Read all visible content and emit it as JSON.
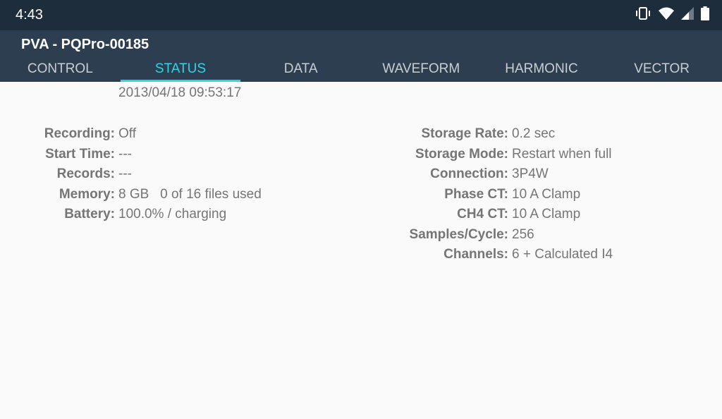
{
  "status_bar": {
    "time": "4:43",
    "icons": [
      "vibrate-icon",
      "wifi-icon",
      "signal-icon",
      "battery-icon"
    ]
  },
  "app_bar": {
    "title": "PVA - PQPro-00185",
    "tabs": [
      {
        "label": "CONTROL",
        "active": false
      },
      {
        "label": "STATUS",
        "active": true
      },
      {
        "label": "DATA",
        "active": false
      },
      {
        "label": "WAVEFORM",
        "active": false
      },
      {
        "label": "HARMONIC",
        "active": false
      },
      {
        "label": "VECTOR",
        "active": false
      }
    ],
    "accent_color": "#2fd4e6"
  },
  "status": {
    "timestamp": "2013/04/18 09:53:17",
    "left": [
      {
        "label": "Recording:",
        "value": "Off"
      },
      {
        "label": "Start Time:",
        "value": "---"
      },
      {
        "label": "Records:",
        "value": "---"
      },
      {
        "label": "Memory:",
        "value": "8 GB   0 of 16 files used"
      },
      {
        "label": "Battery:",
        "value": "100.0% / charging"
      }
    ],
    "right": [
      {
        "label": "Storage Rate:",
        "value": "0.2 sec"
      },
      {
        "label": "Storage Mode:",
        "value": "Restart when full"
      },
      {
        "label": "Connection:",
        "value": "3P4W"
      },
      {
        "label": "Phase CT:",
        "value": "10 A Clamp"
      },
      {
        "label": "CH4 CT:",
        "value": "10 A Clamp"
      },
      {
        "label": "Samples/Cycle:",
        "value": "256"
      },
      {
        "label": "Channels:",
        "value": "6 + Calculated I4"
      }
    ]
  }
}
